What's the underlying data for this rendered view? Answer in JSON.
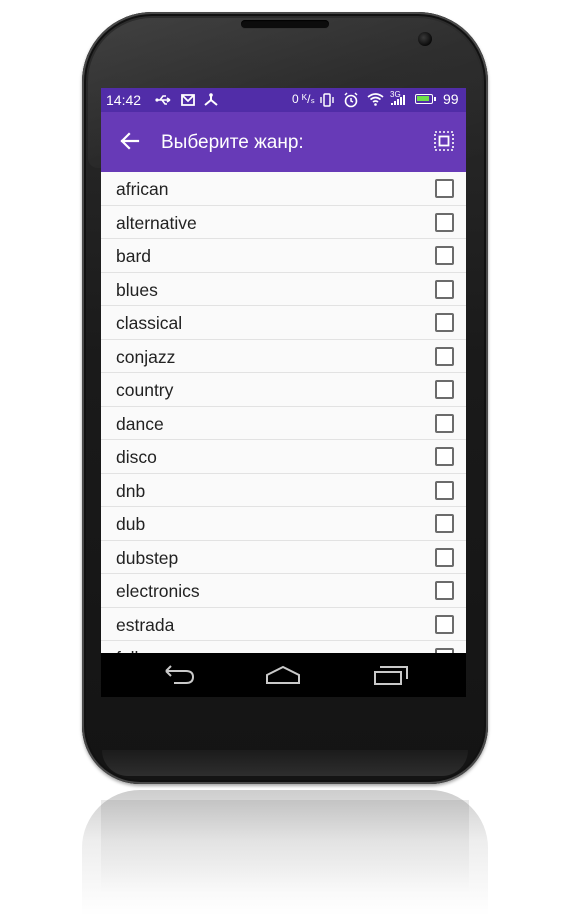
{
  "status_bar": {
    "time": "14:42",
    "net_speed": "0 ᴷ/ₛ",
    "signal_label": "3G",
    "battery_percent": "99",
    "battery_level": 0.99,
    "battery_color": "#6fe04b",
    "left_icons": [
      "usb-icon",
      "gmail-icon",
      "share-icon"
    ],
    "right_icons": [
      "vibrate-icon",
      "alarm-icon",
      "wifi-icon",
      "cell-signal-icon",
      "battery-icon"
    ]
  },
  "app_bar": {
    "title": "Выберите жанр:",
    "background": "#673ab7",
    "status_background": "#512da8"
  },
  "genres": [
    {
      "label": "african",
      "checked": false
    },
    {
      "label": "alternative",
      "checked": false
    },
    {
      "label": "bard",
      "checked": false
    },
    {
      "label": "blues",
      "checked": false
    },
    {
      "label": "classical",
      "checked": false
    },
    {
      "label": "conjazz",
      "checked": false
    },
    {
      "label": "country",
      "checked": false
    },
    {
      "label": "dance",
      "checked": false
    },
    {
      "label": "disco",
      "checked": false
    },
    {
      "label": "dnb",
      "checked": false
    },
    {
      "label": "dub",
      "checked": false
    },
    {
      "label": "dubstep",
      "checked": false
    },
    {
      "label": "electronics",
      "checked": false
    },
    {
      "label": "estrada",
      "checked": false
    },
    {
      "label": "folk",
      "checked": false
    }
  ],
  "nav_bar": {
    "icons": [
      "back-icon",
      "home-icon",
      "recent-apps-icon"
    ]
  }
}
